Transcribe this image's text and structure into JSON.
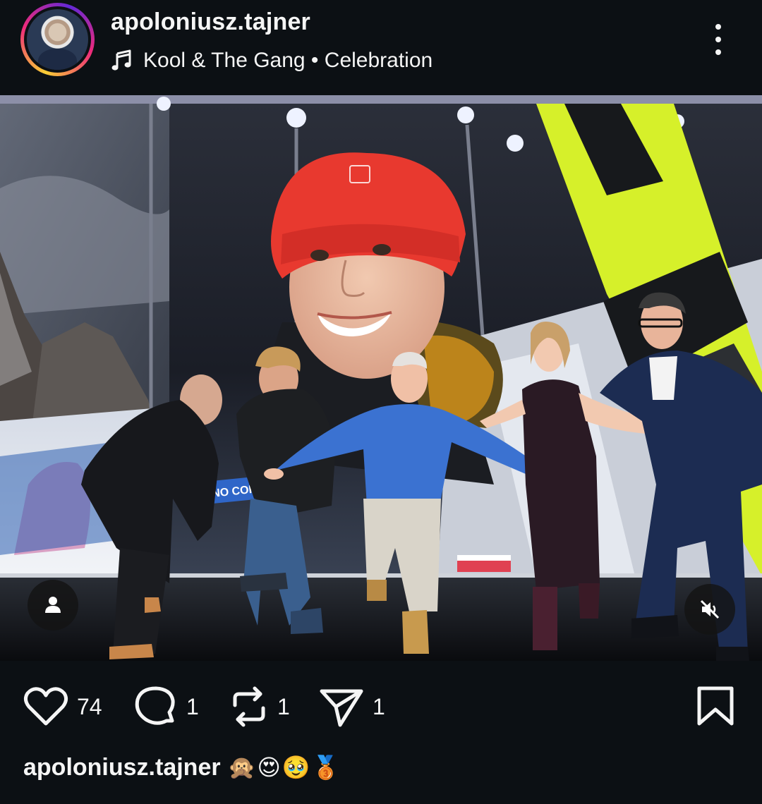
{
  "post": {
    "username": "apoloniusz.tajner",
    "music": "Kool & The Gang • Celebration",
    "icons": {
      "avatar": "avatar",
      "music": "music-note-icon",
      "more": "more-vertical-icon",
      "tag_people": "person-icon",
      "mute": "speaker-muted-icon",
      "like": "heart-icon",
      "comment": "comment-icon",
      "repost": "repost-icon",
      "share": "send-icon",
      "save": "bookmark-icon"
    },
    "media_overlay_text": "MILANO CORTINA"
  },
  "engagement": {
    "likes": "74",
    "comments": "1",
    "reposts": "1",
    "shares": "1"
  },
  "caption": {
    "username": "apoloniusz.tajner",
    "emojis": "🙊😍🥹🥉"
  },
  "colors": {
    "background": "#0c1014",
    "text": "#f5f5f5",
    "accent_ring_start": "#f9ce34",
    "accent_ring_mid": "#ee2a7b",
    "accent_ring_end": "#6228d7"
  }
}
